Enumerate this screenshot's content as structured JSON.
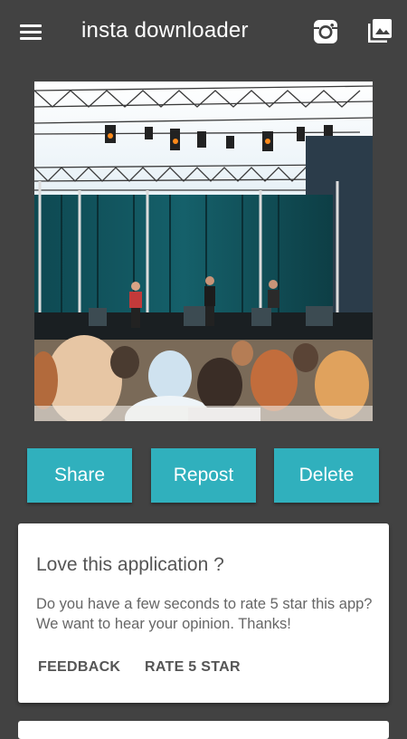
{
  "app_bar": {
    "title": "insta downloader",
    "menu_icon": "hamburger-menu",
    "instagram_icon": "instagram",
    "gallery_icon": "photo-library"
  },
  "media": {
    "description_icon": "concert-photo"
  },
  "actions": {
    "share_label": "Share",
    "repost_label": "Repost",
    "delete_label": "Delete",
    "accent_color": "#30b0bd"
  },
  "rating_card": {
    "title": "Love this application ?",
    "body": "Do you have a few seconds to rate 5 star this app? We want to hear your opinion. Thanks!",
    "feedback_label": "FEEDBACK",
    "rate_label": "RATE 5 STAR"
  }
}
